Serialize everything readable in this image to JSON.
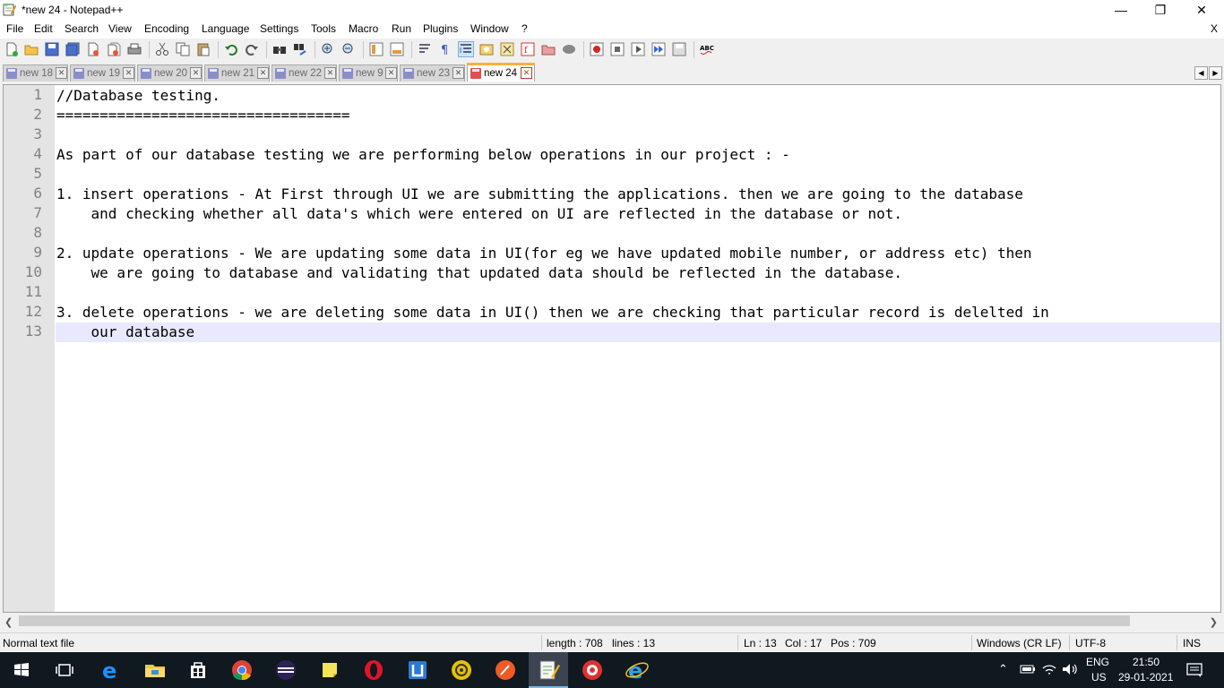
{
  "window": {
    "title": "*new 24 - Notepad++",
    "minimize_glyph": "—",
    "restore_glyph": "❐",
    "close_glyph": "✕"
  },
  "menu": {
    "items": [
      "File",
      "Edit",
      "Search",
      "View",
      "Encoding",
      "Language",
      "Settings",
      "Tools",
      "Macro",
      "Run",
      "Plugins",
      "Window",
      "?"
    ],
    "close_label": "X"
  },
  "toolbar": {
    "icons": [
      "new-file-icon",
      "open-file-icon",
      "save-icon",
      "save-all-icon",
      "close-icon",
      "close-all-icon",
      "print-icon",
      "cut-icon",
      "copy-icon",
      "paste-icon",
      "undo-icon",
      "redo-icon",
      "find-icon",
      "replace-icon",
      "zoom-in-icon",
      "zoom-out-icon",
      "sync-vertical-icon",
      "sync-horizontal-icon",
      "word-wrap-icon",
      "show-all-characters-icon",
      "indent-guide-icon",
      "user-defined-language-icon",
      "document-map-icon",
      "function-list-icon",
      "folder-as-workspace-icon",
      "monitoring-icon",
      "record-macro-icon",
      "stop-macro-icon",
      "play-macro-icon",
      "run-macro-multiple-icon",
      "save-macro-icon",
      "spell-check-icon"
    ]
  },
  "tabs": [
    {
      "label": "new 18",
      "active": false
    },
    {
      "label": "new 19",
      "active": false
    },
    {
      "label": "new 20",
      "active": false
    },
    {
      "label": "new 21",
      "active": false
    },
    {
      "label": "new 22",
      "active": false
    },
    {
      "label": "new 9",
      "active": false
    },
    {
      "label": "new 23",
      "active": false
    },
    {
      "label": "new 24",
      "active": true
    }
  ],
  "editor": {
    "current_line": 13,
    "lines": [
      {
        "num": "1",
        "text": "//Database testing."
      },
      {
        "num": "2",
        "text": "=================================="
      },
      {
        "num": "3",
        "text": ""
      },
      {
        "num": "4",
        "text": "As part of our database testing we are performing below operations in our project : -"
      },
      {
        "num": "5",
        "text": ""
      },
      {
        "num": "6",
        "text": "1. insert operations - At First through UI we are submitting the applications. then we are going to the database"
      },
      {
        "num": "7",
        "text": "    and checking whether all data's which were entered on UI are reflected in the database or not."
      },
      {
        "num": "8",
        "text": ""
      },
      {
        "num": "9",
        "text": "2. update operations - We are updating some data in UI(for eg we have updated mobile number, or address etc) then"
      },
      {
        "num": "10",
        "text": "    we are going to database and validating that updated data should be reflected in the database."
      },
      {
        "num": "11",
        "text": ""
      },
      {
        "num": "12",
        "text": "3. delete operations - we are deleting some data in UI() then we are checking that particular record is delelted in"
      },
      {
        "num": "13",
        "text": "    our database"
      }
    ]
  },
  "statusbar": {
    "file_type": "Normal text file",
    "length": "length : 708",
    "lines": "lines : 13",
    "ln": "Ln : 13",
    "col": "Col : 17",
    "pos": "Pos : 709",
    "eol": "Windows (CR LF)",
    "encoding": "UTF-8",
    "mode": "INS"
  },
  "taskbar": {
    "apps": [
      "task-view-icon",
      "edge-icon",
      "file-explorer-icon",
      "microsoft-store-icon",
      "chrome-icon",
      "eclipse-icon",
      "sticky-notes-icon",
      "opera-icon",
      "app-icon",
      "tray-app-icon",
      "postman-icon",
      "notepadpp-taskbar-icon",
      "recorder-icon",
      "internet-explorer-icon"
    ],
    "language": "ENG",
    "region": "US",
    "time": "21:50",
    "date": "29-01-2021"
  },
  "colors": {
    "active_tab_accent": "#fbb040",
    "current_line_bg": "#e8e8ff",
    "taskbar_bg": "#101820"
  }
}
